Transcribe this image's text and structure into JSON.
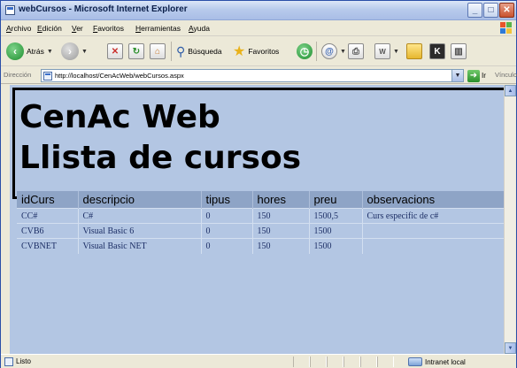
{
  "window": {
    "title": "webCursos - Microsoft Internet Explorer"
  },
  "menu": [
    "Archivo",
    "Edición",
    "Ver",
    "Favoritos",
    "Herramientas",
    "Ayuda"
  ],
  "toolbar": {
    "back_label": "Atrás",
    "search_label": "Búsqueda",
    "favorites_label": "Favoritos"
  },
  "address": {
    "label": "Dirección",
    "url": "http://localhost/CenAcWeb/webCursos.aspx",
    "go_label": "Ir",
    "links_label": "Vínculos"
  },
  "page": {
    "heading_line1": "CenAc Web",
    "heading_line2": "Llista de cursos"
  },
  "table": {
    "headers": [
      "idCurs",
      "descripcio",
      "tipus",
      "hores",
      "preu",
      "observacions"
    ],
    "rows": [
      [
        "CC#",
        "C#",
        "0",
        "150",
        "1500,5",
        "Curs especific de c#"
      ],
      [
        "CVB6",
        "Visual Basic 6",
        "0",
        "150",
        "1500",
        ""
      ],
      [
        "CVBNET",
        "Visual Basic NET",
        "0",
        "150",
        "1500",
        ""
      ]
    ]
  },
  "status": {
    "text": "Listo",
    "zone": "Intranet local"
  },
  "colors": {
    "page_background": "#b3c6e3",
    "table_header": "#8ea4c6",
    "cell_text": "#1d2f66"
  }
}
